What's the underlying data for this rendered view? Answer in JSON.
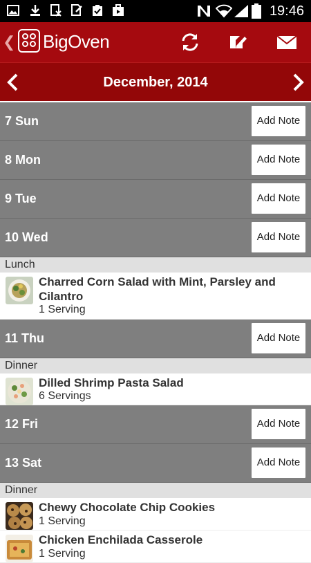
{
  "status_bar": {
    "time": "19:46"
  },
  "app_bar": {
    "brand": "BigOven",
    "icons": [
      "back-chevron-icon",
      "bigoven-logo-icon",
      "sync-icon",
      "edit-note-icon",
      "mail-icon"
    ]
  },
  "calendar": {
    "month": "December, 2014",
    "add_note_label": "Add Note"
  },
  "days": [
    {
      "label": "7 Sun"
    },
    {
      "label": "8 Mon"
    },
    {
      "label": "9 Tue"
    },
    {
      "label": "10 Wed",
      "meals": [
        {
          "name": "Lunch",
          "recipes": [
            {
              "title": "Charred Corn Salad with Mint, Parsley and Cilantro",
              "servings": "1 Serving"
            }
          ]
        }
      ]
    },
    {
      "label": "11 Thu",
      "meals": [
        {
          "name": "Dinner",
          "recipes": [
            {
              "title": "Dilled Shrimp Pasta Salad",
              "servings": "6 Servings"
            }
          ]
        }
      ]
    },
    {
      "label": "12 Fri"
    },
    {
      "label": "13 Sat",
      "meals": [
        {
          "name": "Dinner",
          "recipes": [
            {
              "title": "Chewy Chocolate Chip Cookies",
              "servings": "1 Serving"
            },
            {
              "title": "Chicken Enchilada Casserole",
              "servings": "1 Serving"
            }
          ]
        }
      ]
    }
  ]
}
